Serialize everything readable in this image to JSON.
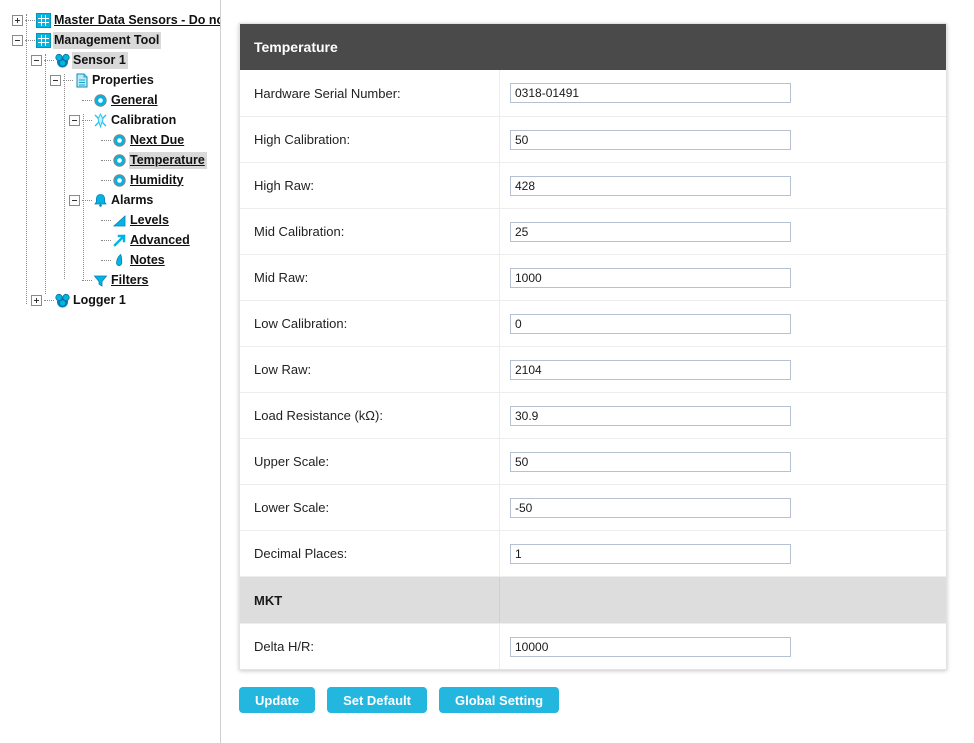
{
  "tree": {
    "nodes": [
      {
        "label": "Master Data Sensors - Do no",
        "icon": "grid-icon",
        "depth": 0,
        "expander": "plus",
        "link": true,
        "selected": false
      },
      {
        "label": "Management Tool",
        "icon": "grid-icon",
        "depth": 0,
        "expander": "minus",
        "link": false,
        "selected": true
      },
      {
        "label": "Sensor 1",
        "icon": "sensor-cluster-icon",
        "depth": 1,
        "expander": "minus",
        "link": false,
        "selected": true
      },
      {
        "label": "Properties",
        "icon": "document-icon",
        "depth": 2,
        "expander": "minus",
        "link": false,
        "selected": false
      },
      {
        "label": "General",
        "icon": "circle-icon",
        "depth": 3,
        "expander": "none",
        "link": true,
        "selected": false
      },
      {
        "label": "Calibration",
        "icon": "calibration-star-icon",
        "depth": 3,
        "expander": "minus",
        "link": false,
        "selected": false
      },
      {
        "label": "Next Due",
        "icon": "circle-icon",
        "depth": 4,
        "expander": "none",
        "link": true,
        "selected": false
      },
      {
        "label": "Temperature",
        "icon": "circle-icon",
        "depth": 4,
        "expander": "none",
        "link": true,
        "selected": true
      },
      {
        "label": "Humidity",
        "icon": "circle-icon",
        "depth": 4,
        "expander": "none",
        "link": true,
        "selected": false
      },
      {
        "label": "Alarms",
        "icon": "bell-icon",
        "depth": 3,
        "expander": "minus",
        "link": false,
        "selected": false
      },
      {
        "label": "Levels",
        "icon": "chart-icon",
        "depth": 4,
        "expander": "none",
        "link": true,
        "selected": false
      },
      {
        "label": "Advanced",
        "icon": "arrow-icon",
        "depth": 4,
        "expander": "none",
        "link": true,
        "selected": false
      },
      {
        "label": "Notes",
        "icon": "pen-icon",
        "depth": 4,
        "expander": "none",
        "link": true,
        "selected": false
      },
      {
        "label": "Filters",
        "icon": "funnel-icon",
        "depth": 3,
        "expander": "none",
        "link": true,
        "selected": false
      },
      {
        "label": "Logger 1",
        "icon": "sensor-cluster-icon",
        "depth": 1,
        "expander": "plus",
        "link": false,
        "selected": false
      }
    ]
  },
  "form": {
    "title": "Temperature",
    "rows": [
      {
        "label": "Hardware Serial Number:",
        "value": "0318-01491"
      },
      {
        "label": "High Calibration:",
        "value": "50"
      },
      {
        "label": "High Raw:",
        "value": "428"
      },
      {
        "label": "Mid Calibration:",
        "value": "25"
      },
      {
        "label": "Mid Raw:",
        "value": "1000"
      },
      {
        "label": "Low Calibration:",
        "value": "0"
      },
      {
        "label": "Low Raw:",
        "value": "2104"
      },
      {
        "label": "Load Resistance (kΩ):",
        "value": "30.9"
      },
      {
        "label": "Upper Scale:",
        "value": "50"
      },
      {
        "label": "Lower Scale:",
        "value": "-50"
      },
      {
        "label": "Decimal Places:",
        "value": "1"
      }
    ],
    "subsection": {
      "label": "MKT"
    },
    "subsection_rows": [
      {
        "label": "Delta H/R:",
        "value": "10000"
      }
    ]
  },
  "buttons": [
    {
      "label": "Update"
    },
    {
      "label": "Set Default"
    },
    {
      "label": "Global Setting"
    }
  ],
  "colors": {
    "header_bg": "#4a4a4a",
    "accent": "#23b6de",
    "icon_cyan": "#00b5e2",
    "subhead_bg": "#dddddd",
    "selection_bg": "#d9d9d9"
  }
}
